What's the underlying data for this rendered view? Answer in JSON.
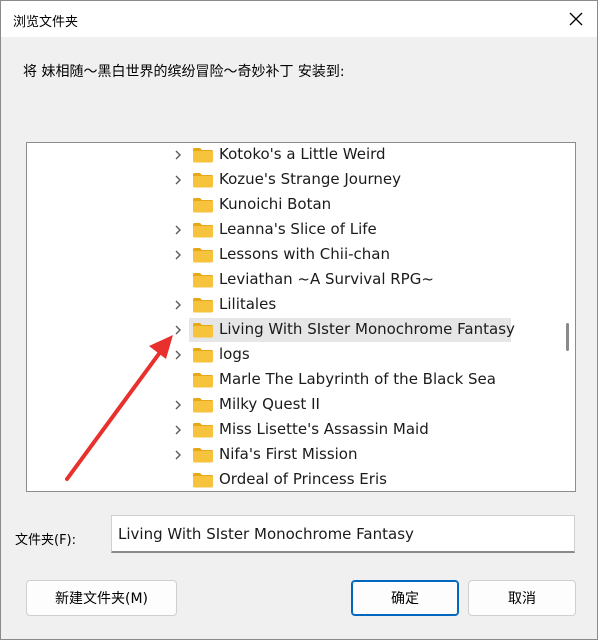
{
  "window": {
    "title": "浏览文件夹"
  },
  "prompt": "将 妹相随～黑白世界的缤纷冒险～奇妙补丁 安装到:",
  "tree": {
    "items": [
      {
        "label": "Kotoko's a Little Weird",
        "expandable": true,
        "selected": false
      },
      {
        "label": "Kozue's Strange Journey",
        "expandable": true,
        "selected": false
      },
      {
        "label": "Kunoichi Botan",
        "expandable": false,
        "selected": false
      },
      {
        "label": "Leanna's Slice of Life",
        "expandable": true,
        "selected": false
      },
      {
        "label": "Lessons with Chii-chan",
        "expandable": true,
        "selected": false
      },
      {
        "label": "Leviathan ~A Survival RPG~",
        "expandable": false,
        "selected": false
      },
      {
        "label": "Lilitales",
        "expandable": true,
        "selected": false
      },
      {
        "label": "Living With SIster Monochrome Fantasy",
        "expandable": true,
        "selected": true
      },
      {
        "label": "logs",
        "expandable": true,
        "selected": false
      },
      {
        "label": "Marle The Labyrinth of the Black Sea",
        "expandable": false,
        "selected": false
      },
      {
        "label": "Milky Quest II",
        "expandable": true,
        "selected": false
      },
      {
        "label": "Miss Lisette's Assassin Maid",
        "expandable": true,
        "selected": false
      },
      {
        "label": "Nifa's First Mission",
        "expandable": true,
        "selected": false
      },
      {
        "label": "Ordeal of Princess Eris",
        "expandable": false,
        "selected": false
      }
    ]
  },
  "folder": {
    "label": "文件夹(F):",
    "value": "Living With SIster Monochrome Fantasy"
  },
  "buttons": {
    "new_folder": "新建文件夹(M)",
    "ok": "确定",
    "cancel": "取消"
  },
  "colors": {
    "folder": "#f8c33c",
    "arrow": "#e8312d",
    "accent": "#0067c0"
  },
  "icons": {
    "close": "close-icon",
    "folder": "folder-icon",
    "chevron": "chevron-right-icon"
  }
}
